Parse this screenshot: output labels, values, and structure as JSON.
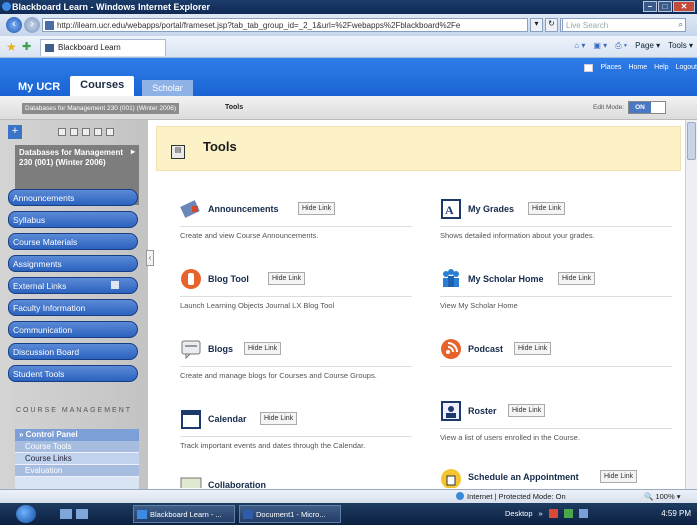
{
  "window": {
    "title": "Blackboard Learn - Windows Internet Explorer",
    "controls": [
      "–",
      "□",
      "✕"
    ]
  },
  "address_bar": {
    "url": "http://ilearn.ucr.edu/webapps/portal/frameset.jsp?tab_tab_group_id=_2_1&url=%2Fwebapps%2Fblackboard%2Fe",
    "search_placeholder": "Live Search"
  },
  "browser_tab": {
    "label": "Blackboard Learn"
  },
  "command_bar": {
    "page_label": "Page ▾",
    "tools_label": "Tools ▾"
  },
  "bb_top_links": [
    "Places",
    "Home",
    "Help",
    "Logout"
  ],
  "bb_tabs": {
    "my_ucr": "My UCR",
    "courses": "Courses",
    "scholar": "Scholar"
  },
  "breadcrumb": {
    "course": "Databases for Management 230 (001) (Winter 2006)",
    "current": "Tools",
    "edit_mode_label": "Edit Mode:",
    "edit_mode_value": "ON"
  },
  "sidebar": {
    "course_title": "Databases for Management 230 (001) (Winter 2006)",
    "menu_items": [
      {
        "label": "Announcements"
      },
      {
        "label": "Syllabus"
      },
      {
        "label": "Course Materials"
      },
      {
        "label": "Assignments"
      },
      {
        "label": "External Links"
      },
      {
        "label": "Faculty Information"
      },
      {
        "label": "Communication"
      },
      {
        "label": "Discussion Board"
      },
      {
        "label": "Student Tools"
      }
    ],
    "course_management_heading": "COURSE MANAGEMENT",
    "control_panel": {
      "title": "Control Panel",
      "items": [
        "Course Tools",
        "Course Links",
        "Evaluation"
      ]
    }
  },
  "main": {
    "header_title": "Tools",
    "hide_link_label": "Hide Link",
    "tools_left": [
      {
        "name": "Announcements",
        "icon": "announcements-icon",
        "desc": "Create and view Course Announcements."
      },
      {
        "name": "Blog Tool",
        "icon": "blog-tool-icon",
        "desc": "Launch Learning Objects Journal LX Blog Tool"
      },
      {
        "name": "Blogs",
        "icon": "blogs-icon",
        "desc": "Create and manage blogs for Courses and Course Groups."
      },
      {
        "name": "Calendar",
        "icon": "calendar-icon",
        "desc": "Track important events and dates through the Calendar."
      }
    ],
    "tools_right": [
      {
        "name": "My Grades",
        "icon": "grades-icon",
        "desc": "Shows detailed information about your grades."
      },
      {
        "name": "My Scholar Home",
        "icon": "scholar-home-icon",
        "desc": "View My Scholar Home"
      },
      {
        "name": "Podcast",
        "icon": "podcast-icon",
        "desc": ""
      },
      {
        "name": "Roster",
        "icon": "roster-icon",
        "desc": "View a list of users enrolled in the Course."
      },
      {
        "name": "Schedule an Appointment",
        "icon": "schedule-icon",
        "desc": ""
      }
    ],
    "partial_tool": "Collaboration"
  },
  "status_bar": {
    "zone": "Internet | Protected Mode: On",
    "zoom": "100%"
  },
  "taskbar": {
    "buttons": [
      "Blackboard Learn - ...",
      "Document1 - Micro..."
    ],
    "desktop_label": "Desktop",
    "clock": "4:59 PM"
  },
  "colors": {
    "bb_blue": "#1a63d4",
    "menu_blue": "#2c62bf",
    "tools_header_bg": "#fdf2c7"
  }
}
